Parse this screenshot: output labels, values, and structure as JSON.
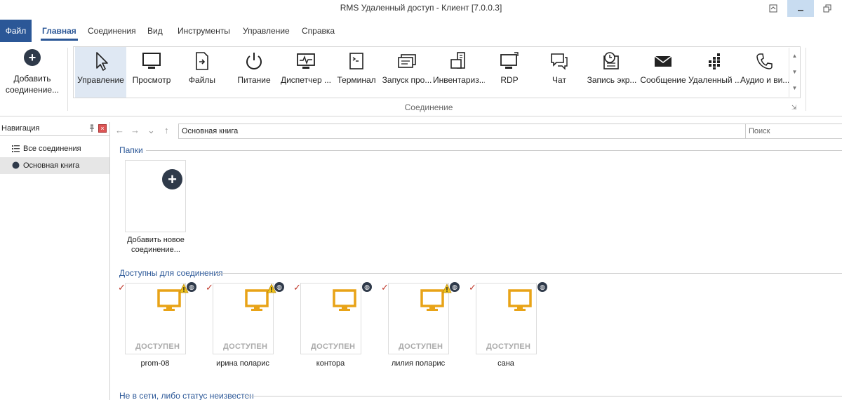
{
  "window": {
    "title": "RMS Удаленный доступ - Клиент [7.0.0.3]"
  },
  "menu": {
    "file": "Файл",
    "tabs": [
      "Главная",
      "Соединения",
      "Вид",
      "Инструменты",
      "Управление",
      "Справка"
    ]
  },
  "ribbon": {
    "add_label_1": "Добавить",
    "add_label_2": "соединение...",
    "group_label": "Соединение",
    "buttons": [
      {
        "label": "Управление",
        "icon": "cursor-icon"
      },
      {
        "label": "Просмотр",
        "icon": "monitor-icon"
      },
      {
        "label": "Файлы",
        "icon": "file-transfer-icon"
      },
      {
        "label": "Питание",
        "icon": "power-icon"
      },
      {
        "label": "Диспетчер ...",
        "icon": "task-manager-icon"
      },
      {
        "label": "Терминал",
        "icon": "terminal-icon"
      },
      {
        "label": "Запуск про...",
        "icon": "run-program-icon"
      },
      {
        "label": "Инвентариз...",
        "icon": "inventory-icon"
      },
      {
        "label": "RDP",
        "icon": "rdp-icon"
      },
      {
        "label": "Чат",
        "icon": "chat-icon"
      },
      {
        "label": "Запись экр...",
        "icon": "screen-record-icon"
      },
      {
        "label": "Сообщение",
        "icon": "envelope-icon"
      },
      {
        "label": "Удаленный ...",
        "icon": "remote-install-icon"
      },
      {
        "label": "Аудио и ви...",
        "icon": "phone-icon"
      }
    ]
  },
  "navigation": {
    "title": "Навигация",
    "items": [
      {
        "label": "Все соединения",
        "icon": "list-icon"
      },
      {
        "label": "Основная книга",
        "icon": "book-icon"
      }
    ]
  },
  "address": {
    "path": "Основная книга",
    "search_placeholder": "Поиск"
  },
  "folders": {
    "title": "Папки",
    "add_label": "Добавить новое соединение..."
  },
  "available": {
    "title": "Доступны для соединения",
    "connections": [
      {
        "name": "prom-08",
        "status": "ДОСТУПЕН",
        "warning": true
      },
      {
        "name": "ирина поларис",
        "status": "ДОСТУПЕН",
        "warning": true
      },
      {
        "name": "контора",
        "status": "ДОСТУПЕН",
        "warning": false
      },
      {
        "name": "лилия поларис",
        "status": "ДОСТУПЕН",
        "warning": true
      },
      {
        "name": "сана",
        "status": "ДОСТУПЕН",
        "warning": false
      }
    ]
  },
  "offline": {
    "title": "Не в сети, либо статус неизвестен"
  },
  "colors": {
    "accent": "#2b5797",
    "monitor": "#e8a317",
    "check": "#c0392b"
  }
}
